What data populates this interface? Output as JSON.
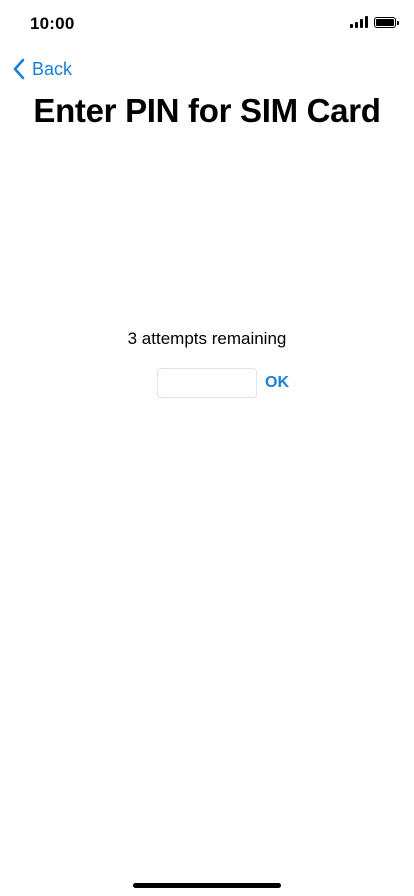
{
  "status_bar": {
    "time": "10:00",
    "signal_icon": "cellular-signal-icon",
    "battery_icon": "battery-icon",
    "battery_level": 1.0
  },
  "nav": {
    "back_label": "Back",
    "back_icon": "chevron-left-icon"
  },
  "page": {
    "title": "Enter PIN for SIM Card",
    "attempts_text": "3 attempts remaining",
    "pin_value": "",
    "pin_placeholder": "",
    "ok_label": "OK"
  },
  "colors": {
    "accent": "#1a7fd4",
    "text": "#000000",
    "background": "#ffffff",
    "input_border": "#e3e3e3"
  }
}
